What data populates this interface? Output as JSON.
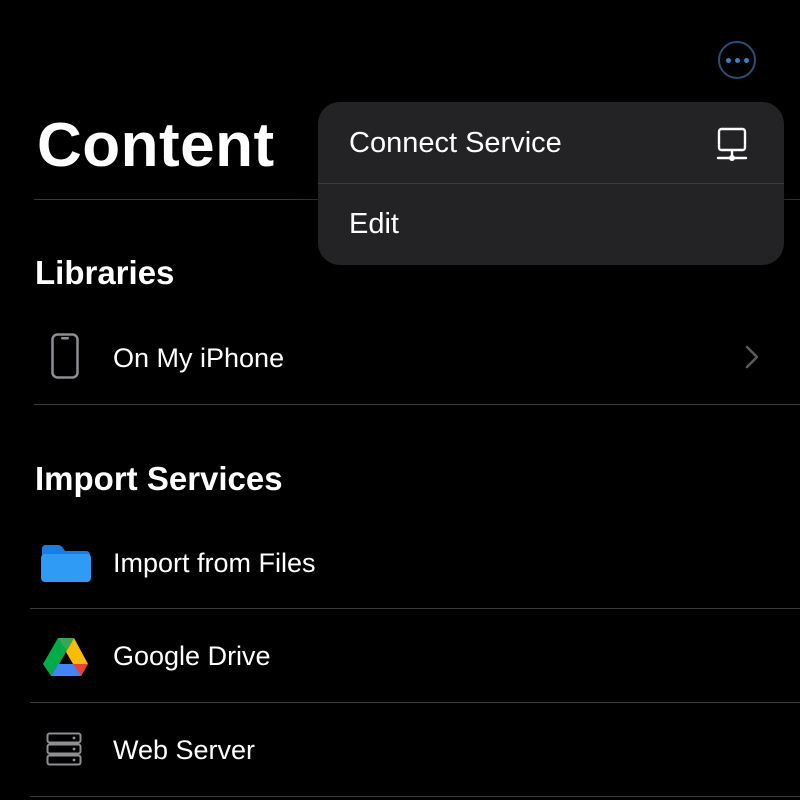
{
  "header": {
    "title": "Content",
    "more_icon": "ellipsis-circle-icon",
    "accent_color": "#3f7fbf"
  },
  "menu": {
    "items": [
      {
        "label": "Connect Service",
        "icon": "network-computer-icon"
      },
      {
        "label": "Edit"
      }
    ]
  },
  "libraries": {
    "header": "Libraries",
    "items": [
      {
        "label": "On My iPhone",
        "icon": "iphone-icon",
        "has_chevron": true
      }
    ]
  },
  "import_services": {
    "header": "Import Services",
    "items": [
      {
        "label": "Import from Files",
        "icon": "folder-icon",
        "icon_color": "#2f9bf5"
      },
      {
        "label": "Google Drive",
        "icon": "google-drive-icon"
      },
      {
        "label": "Web Server",
        "icon": "server-icon"
      }
    ]
  }
}
